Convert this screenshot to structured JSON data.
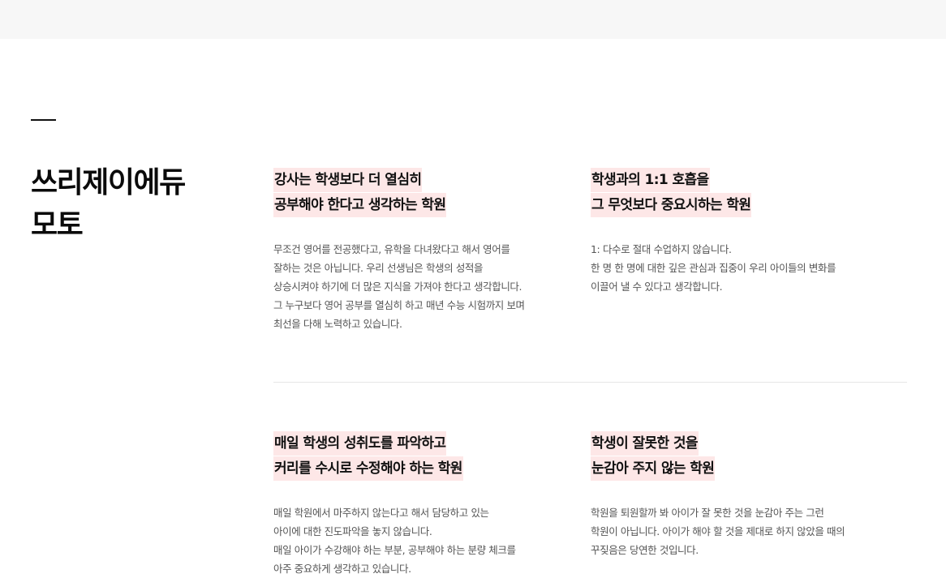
{
  "section": {
    "title_lines": [
      "쓰리제이에듀",
      "모토"
    ]
  },
  "mottos": [
    {
      "heading_lines": [
        "강사는 학생보다 더 열심히",
        "공부해야 한다고 생각하는 학원"
      ],
      "body_lines": [
        "무조건 영어를 전공했다고, 유학을 다녀왔다고 해서 영어를",
        "잘하는 것은 아닙니다. 우리 선생님은 학생의 성적을",
        "상승시켜야 하기에 더 많은 지식을 가져야 한다고 생각합니다.",
        "그 누구보다 영어 공부를 열심히 하고 매년 수능 시험까지 보며",
        "최선을 다해 노력하고 있습니다."
      ]
    },
    {
      "heading_lines": [
        "학생과의 1:1 호흡을",
        "그 무엇보다 중요시하는 학원"
      ],
      "body_lines": [
        "1: 다수로 절대 수업하지 않습니다.",
        "한 명 한 명에 대한 깊은 관심과 집중이 우리 아이들의 변화를",
        "이끌어 낼 수 있다고 생각합니다."
      ]
    },
    {
      "heading_lines": [
        "매일 학생의 성취도를 파악하고",
        "커리를 수시로 수정해야 하는 학원"
      ],
      "body_lines": [
        "매일 학원에서 마주하지 않는다고 해서 담당하고 있는",
        "아이에 대한 진도파악을 놓지 않습니다.",
        "매일 아이가 수강해야 하는 부분, 공부해야 하는 분량 체크를",
        "아주 중요하게 생각하고 있습니다."
      ]
    },
    {
      "heading_lines": [
        "학생이 잘못한 것을",
        "눈감아 주지 않는 학원"
      ],
      "body_lines": [
        "학원을 퇴원할까 봐 아이가 잘 못한 것을 눈감아 주는 그런",
        "학원이 아닙니다. 아이가 해야 할 것을 제대로 하지 않았을 때의",
        "꾸짖음은 당연한 것입니다."
      ]
    }
  ],
  "colors": {
    "highlight": "#fde7e7",
    "top_band": "#f7f7f7",
    "divider": "#e6e6e6"
  }
}
